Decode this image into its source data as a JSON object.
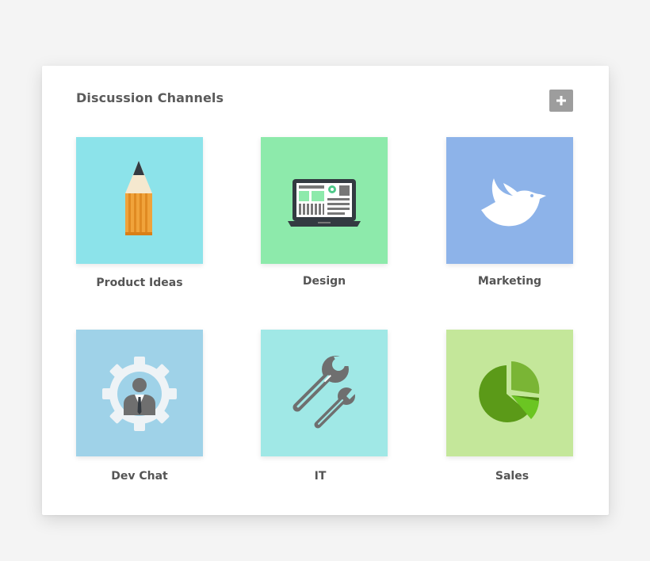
{
  "header": {
    "title": "Discussion Channels",
    "add_icon": "plus-icon"
  },
  "channels": [
    {
      "label": "Product Ideas",
      "color": "#8ce3ea",
      "icon": "pencil-icon"
    },
    {
      "label": "Design",
      "color": "#8deaab",
      "icon": "laptop-icon"
    },
    {
      "label": "Marketing",
      "color": "#8db3e9",
      "icon": "bird-icon"
    },
    {
      "label": "Dev Chat",
      "color": "#9fd2e8",
      "icon": "gear-person-icon"
    },
    {
      "label": "IT",
      "color": "#a0e8e6",
      "icon": "wrench-icon"
    },
    {
      "label": "Sales",
      "color": "#c4e79a",
      "icon": "pie-chart-icon"
    }
  ]
}
